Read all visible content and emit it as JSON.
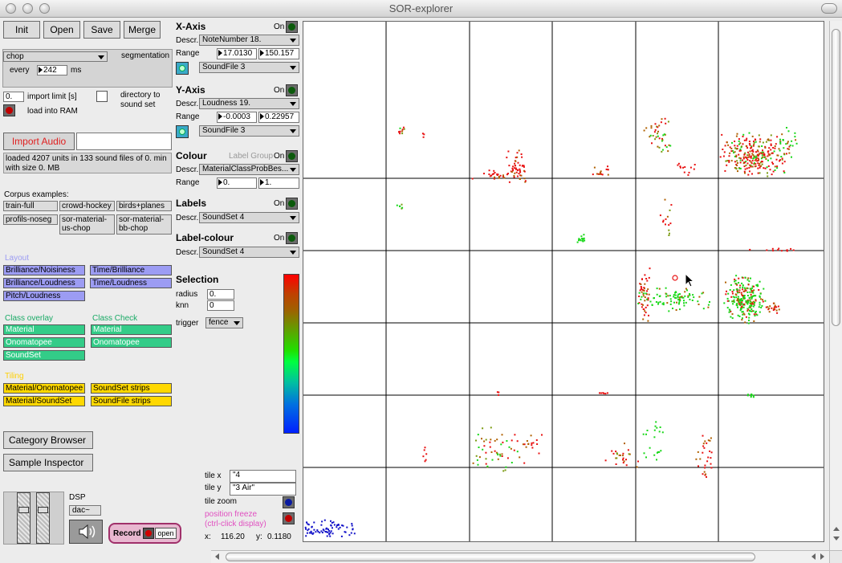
{
  "window": {
    "title": "SOR-explorer"
  },
  "toolbar": {
    "init": "Init",
    "open": "Open",
    "save": "Save",
    "merge": "Merge"
  },
  "segmentation": {
    "method": "chop",
    "label": "segmentation",
    "every_label": "every",
    "every_value": "242",
    "unit": "ms",
    "import_limit_value": "0.",
    "import_limit_label": "import limit [s]",
    "directory_label_1": "directory to",
    "directory_label_2": "sound set",
    "load_ram_label": "load into RAM"
  },
  "import": {
    "button": "Import Audio",
    "path": "",
    "status_line1": "loaded 4207 units in 133 sound files of 0. min",
    "status_line2": "with size 0. MB"
  },
  "corpus": {
    "title": "Corpus examples:",
    "items": [
      "train-full",
      "crowd-hockey",
      "birds+planes",
      "profils-noseg"
    ],
    "item_sor_us_1": "sor-material-",
    "item_sor_us_2": "us-chop",
    "item_sor_bb_1": "sor-material-",
    "item_sor_bb_2": "bb-chop"
  },
  "layout": {
    "title": "Layout",
    "items": [
      "Brilliance/Noisiness",
      "Time/Brilliance",
      "Brilliance/Loudness",
      "Time/Loudness",
      "Pitch/Loudness"
    ]
  },
  "class_overlay": {
    "title": "Class overlay",
    "items": [
      "Material",
      "Onomatopee",
      "SoundSet"
    ]
  },
  "class_check": {
    "title": "Class Check",
    "items": [
      "Material",
      "Onomatopee"
    ]
  },
  "tiling": {
    "title": "Tiling",
    "items": [
      "Material/Onomatopee",
      "SoundSet strips",
      "Material/SoundSet",
      "SoundFile strips"
    ]
  },
  "browsers": {
    "category": "Category Browser",
    "sample": "Sample Inspector"
  },
  "audio": {
    "dsp_label": "DSP",
    "dac": "dac~",
    "record": "Record",
    "open": "open"
  },
  "xaxis": {
    "title": "X-Axis",
    "on": "On",
    "descr_label": "Descr.",
    "descr": "NoteNumber 18.",
    "range_label": "Range",
    "min": "17.0130",
    "max": "150.157",
    "file": "SoundFile 3"
  },
  "yaxis": {
    "title": "Y-Axis",
    "on": "On",
    "descr_label": "Descr.",
    "descr": "Loudness 19.",
    "range_label": "Range",
    "min": "-0.0003",
    "max": "0.22957",
    "file": "SoundFile 3"
  },
  "colour": {
    "title": "Colour",
    "group": "Label Group",
    "on": "On",
    "descr_label": "Descr.",
    "descr": "MaterialClassProbBes...",
    "range_label": "Range",
    "min": "0.",
    "max": "1."
  },
  "labels": {
    "title": "Labels",
    "on": "On",
    "descr_label": "Descr.",
    "descr": "SoundSet 4"
  },
  "label_colour": {
    "title": "Label-colour",
    "on": "On",
    "descr_label": "Descr.",
    "descr": "SoundSet 4"
  },
  "selection": {
    "title": "Selection",
    "radius_label": "radius",
    "radius": "0.",
    "knn_label": "knn",
    "knn": "0",
    "trigger_label": "trigger",
    "trigger": "fence"
  },
  "tile": {
    "x_label": "tile x",
    "x_value": "\"4",
    "y_label": "tile y",
    "y_value": "\"3 Air\"",
    "zoom_label": "tile zoom",
    "freeze_1": "position freeze",
    "freeze_2": "(ctrl-click display)",
    "coord_x_label": "x:",
    "coord_x": "116.20",
    "coord_y_label": "y:",
    "coord_y": "0.1180"
  },
  "colors": {
    "accent_red": "#e02020",
    "layout_purple": "#9c9cf3",
    "class_green": "#33cc88",
    "tiling_yellow": "#ffd800"
  }
}
